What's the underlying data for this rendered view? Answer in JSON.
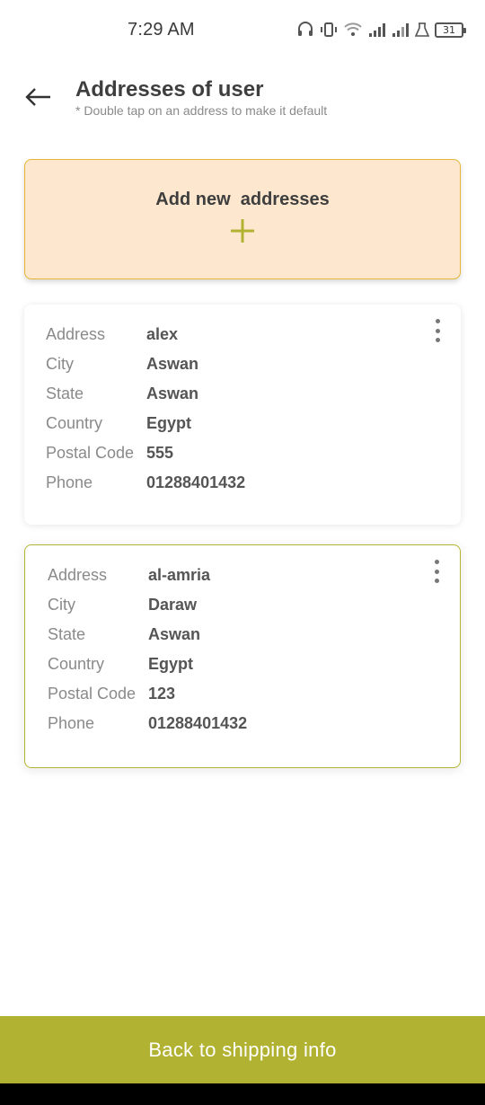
{
  "status_bar": {
    "time": "7:29 AM",
    "battery": "31",
    "icons": [
      "headset-icon",
      "vibrate-icon",
      "wifi-icon",
      "signal-icon",
      "signal-icon",
      "flask-icon",
      "battery-icon"
    ]
  },
  "header": {
    "back_icon": "arrow-left-icon",
    "title": "Addresses of user",
    "subtitle": "* Double tap on an address to make it default"
  },
  "add_card": {
    "label": "Add new  addresses",
    "icon": "plus-icon"
  },
  "addresses": [
    {
      "rows": [
        {
          "key": "Address",
          "value": "alex"
        },
        {
          "key": "City",
          "value": "Aswan"
        },
        {
          "key": "State",
          "value": "Aswan"
        },
        {
          "key": "Country",
          "value": "Egypt"
        },
        {
          "key": "Postal Code",
          "value": "555"
        },
        {
          "key": "Phone",
          "value": "01288401432"
        }
      ]
    },
    {
      "rows": [
        {
          "key": "Address",
          "value": "al-amria"
        },
        {
          "key": "City",
          "value": "Daraw"
        },
        {
          "key": "State",
          "value": "Aswan"
        },
        {
          "key": "Country",
          "value": "Egypt"
        },
        {
          "key": "Postal Code",
          "value": "123"
        },
        {
          "key": "Phone",
          "value": "01288401432"
        }
      ]
    }
  ],
  "footer": {
    "button_label": "Back to shipping info"
  },
  "colors": {
    "accent": "#b2b232",
    "add_card_bg": "#fde8cf",
    "add_card_border": "#e6b536"
  }
}
